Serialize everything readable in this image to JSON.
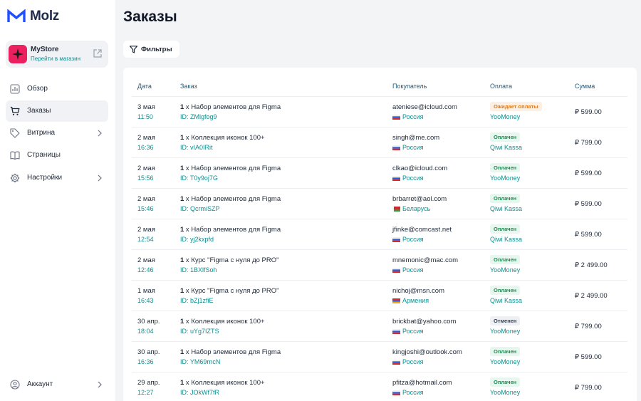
{
  "app": {
    "logo_text": "Molz"
  },
  "store": {
    "name": "MyStore",
    "link_label": "Перейти в магазин"
  },
  "nav": [
    {
      "label": "Обзор",
      "icon": "chart-icon",
      "active": false,
      "chevron": false
    },
    {
      "label": "Заказы",
      "icon": "cart-icon",
      "active": true,
      "chevron": false
    },
    {
      "label": "Витрина",
      "icon": "tag-icon",
      "active": false,
      "chevron": true
    },
    {
      "label": "Страницы",
      "icon": "book-icon",
      "active": false,
      "chevron": false
    },
    {
      "label": "Настройки",
      "icon": "gear-icon",
      "active": false,
      "chevron": true
    }
  ],
  "account": {
    "label": "Аккаунт"
  },
  "page": {
    "title": "Заказы",
    "filters_label": "Фильтры"
  },
  "table": {
    "headers": {
      "date": "Дата",
      "order": "Заказ",
      "buyer": "Покупатель",
      "payment": "Оплата",
      "sum": "Сумма"
    },
    "rows": [
      {
        "date": "3 мая",
        "time": "11:50",
        "qty": "1",
        "product": " x Набор элементов для Figma",
        "id": "ID: ZMlgfog9",
        "email": "ateniese@icloud.com",
        "country": "Россия",
        "flag": "ru",
        "status": "Ожидает оплаты",
        "status_kind": "wait",
        "method": "YooMoney",
        "sum": "₽ 599.00"
      },
      {
        "date": "2 мая",
        "time": "16:36",
        "qty": "1",
        "product": " x Коллекция иконок 100+",
        "id": "ID: vIA0IRit",
        "email": "singh@me.com",
        "country": "Россия",
        "flag": "ru",
        "status": "Оплачен",
        "status_kind": "paid",
        "method": "Qiwi Kassa",
        "sum": "₽ 799.00"
      },
      {
        "date": "2 мая",
        "time": "15:56",
        "qty": "1",
        "product": " x Набор элементов для Figma",
        "id": "ID: T0y9oj7G",
        "email": "clkao@icloud.com",
        "country": "Россия",
        "flag": "ru",
        "status": "Оплачен",
        "status_kind": "paid",
        "method": "YooMoney",
        "sum": "₽ 599.00"
      },
      {
        "date": "2 мая",
        "time": "15:46",
        "qty": "1",
        "product": " x Набор элементов для Figma",
        "id": "ID: QcrmiSZP",
        "email": "brbarret@aol.com",
        "country": "Беларусь",
        "flag": "by",
        "status": "Оплачен",
        "status_kind": "paid",
        "method": "Qiwi Kassa",
        "sum": "₽ 599.00"
      },
      {
        "date": "2 мая",
        "time": "12:54",
        "qty": "1",
        "product": " x Набор элементов для Figma",
        "id": "ID: yj2kxpfd",
        "email": "jfinke@comcast.net",
        "country": "Россия",
        "flag": "ru",
        "status": "Оплачен",
        "status_kind": "paid",
        "method": "Qiwi Kassa",
        "sum": "₽ 599.00"
      },
      {
        "date": "2 мая",
        "time": "12:46",
        "qty": "1",
        "product": " x Курс \"Figma с нуля до PRO\"",
        "id": "ID: 1BXlfSoh",
        "email": "mnemonic@mac.com",
        "country": "Россия",
        "flag": "ru",
        "status": "Оплачен",
        "status_kind": "paid",
        "method": "YooMoney",
        "sum": "₽ 2 499.00"
      },
      {
        "date": "1 мая",
        "time": "16:43",
        "qty": "1",
        "product": " x Курс \"Figma с нуля до PRO\"",
        "id": "ID: bZj1zfiE",
        "email": "nichoj@msn.com",
        "country": "Армения",
        "flag": "am",
        "status": "Оплачен",
        "status_kind": "paid",
        "method": "Qiwi Kassa",
        "sum": "₽ 2 499.00"
      },
      {
        "date": "30 апр.",
        "time": "18:04",
        "qty": "1",
        "product": " x Коллекция иконок 100+",
        "id": "ID: uYg7IZTS",
        "email": "brickbat@yahoo.com",
        "country": "Россия",
        "flag": "ru",
        "status": "Отменен",
        "status_kind": "canc",
        "method": "YooMoney",
        "sum": "₽ 799.00"
      },
      {
        "date": "30 апр.",
        "time": "16:36",
        "qty": "1",
        "product": " x Набор элементов для Figma",
        "id": "ID: YM69rncN",
        "email": "kingjoshi@outlook.com",
        "country": "Россия",
        "flag": "ru",
        "status": "Оплачен",
        "status_kind": "paid",
        "method": "YooMoney",
        "sum": "₽ 599.00"
      },
      {
        "date": "29 апр.",
        "time": "12:27",
        "qty": "1",
        "product": " x Коллекция иконок 100+",
        "id": "ID: JOkWf7fR",
        "email": "pfitza@hotmail.com",
        "country": "Россия",
        "flag": "ru",
        "status": "Оплачен",
        "status_kind": "paid",
        "method": "YooMoney",
        "sum": "₽ 799.00"
      }
    ]
  },
  "colors": {
    "accent": "#0f8f8f",
    "brand_store": "#ec1f5f",
    "paid": "#1a8f52",
    "wait": "#e07a1b"
  }
}
